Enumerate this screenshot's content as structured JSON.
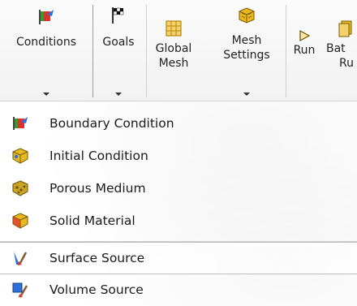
{
  "ribbon": {
    "conditions_label": "Conditions",
    "goals_label": "Goals",
    "global_mesh_line1": "Global",
    "global_mesh_line2": "Mesh",
    "mesh_settings_line1": "Mesh",
    "mesh_settings_line2": "Settings",
    "run_label": "Run",
    "batch_run_line1": "Bat",
    "batch_run_line2": "Ru"
  },
  "menu": {
    "items": [
      {
        "label": "Boundary Condition",
        "icon": "boundary-condition-icon"
      },
      {
        "label": "Initial Condition",
        "icon": "initial-condition-icon"
      },
      {
        "label": "Porous Medium",
        "icon": "porous-medium-icon"
      },
      {
        "label": "Solid Material",
        "icon": "solid-material-icon"
      },
      {
        "label": "Surface Source",
        "icon": "surface-source-icon"
      },
      {
        "label": "Volume Source",
        "icon": "volume-source-icon"
      }
    ]
  },
  "colors": {
    "flag_green": "#3a9a2c",
    "flag_red": "#d9342b",
    "cube_yellow": "#e8b923",
    "accent_blue": "#2f6fd8"
  }
}
